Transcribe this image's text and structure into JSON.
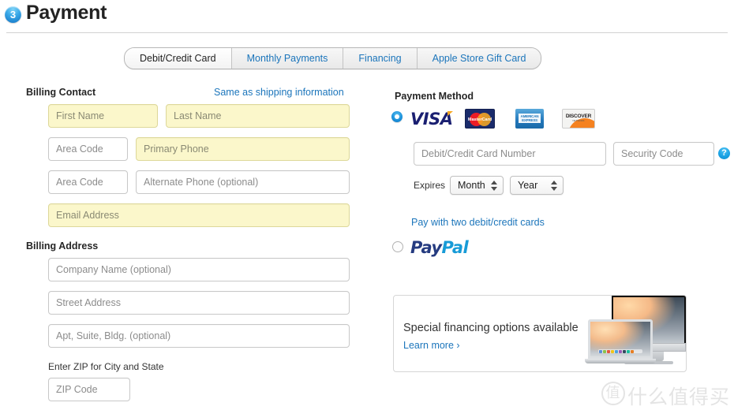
{
  "header": {
    "step_number": "3",
    "title": "Payment"
  },
  "tabs": [
    {
      "label": "Debit/Credit Card",
      "active": true
    },
    {
      "label": "Monthly Payments",
      "active": false
    },
    {
      "label": "Financing",
      "active": false
    },
    {
      "label": "Apple Store Gift Card",
      "active": false
    }
  ],
  "billing_contact": {
    "heading": "Billing Contact",
    "same_as_shipping_link": "Same as shipping information",
    "fields": {
      "first_name": "First Name",
      "last_name": "Last Name",
      "area_code_primary": "Area Code",
      "primary_phone": "Primary Phone",
      "area_code_alternate": "Area Code",
      "alternate_phone": "Alternate Phone (optional)",
      "email": "Email Address"
    }
  },
  "billing_address": {
    "heading": "Billing Address",
    "fields": {
      "company": "Company Name (optional)",
      "street": "Street Address",
      "apt": "Apt, Suite, Bldg. (optional)",
      "zip": "ZIP Code"
    },
    "zip_hint": "Enter ZIP for City and State"
  },
  "payment_method": {
    "heading": "Payment Method",
    "card_logos": [
      "visa-logo",
      "mastercard-logo",
      "amex-logo",
      "discover-logo"
    ],
    "mastercard_text": "MasterCard",
    "amex_line1": "AMERICAN",
    "amex_line2": "EXPRESS",
    "discover_text": "DISCOVER",
    "discover_sub": "NETWORK",
    "visa_text": "VISA",
    "card_number_placeholder": "Debit/Credit Card Number",
    "security_code_placeholder": "Security Code",
    "help_icon": "?",
    "expires_label": "Expires",
    "month_value": "Month",
    "year_value": "Year",
    "two_cards_link": "Pay with two debit/credit cards",
    "paypal_a": "Pay",
    "paypal_b": "Pal"
  },
  "promo": {
    "title": "Special financing options available",
    "link": "Learn more ›"
  },
  "watermark": {
    "badge": "值",
    "text": "什么值得买"
  },
  "colors": {
    "link": "#1b75bb",
    "required_field_bg": "#fbf7cb",
    "accent": "#1d93dd"
  }
}
